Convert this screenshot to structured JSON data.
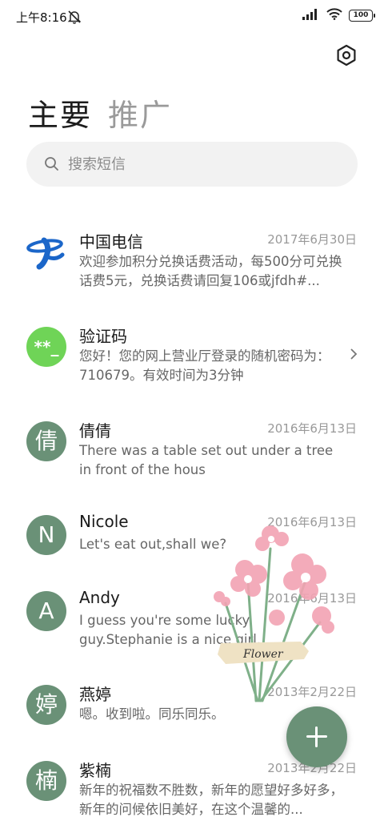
{
  "status_bar": {
    "time": "上午8:16",
    "battery": "100"
  },
  "tabs": [
    {
      "label": "主要",
      "active": true
    },
    {
      "label": "推广",
      "active": false
    }
  ],
  "search": {
    "placeholder": "搜索短信"
  },
  "accent_color": "#6a9177",
  "conversations": [
    {
      "name": "中国电信",
      "date": "2017年6月30日",
      "preview": "欢迎参加积分兑换话费活动，每500分可兑换话费5元，兑换话费请回复106或jfdh#...",
      "avatar": "china-telecom-logo"
    },
    {
      "name": "验证码",
      "date": "",
      "preview": "您好！您的网上营业厅登录的随机密码为：710679。有效时间为3分钟",
      "avatar": "**_"
    },
    {
      "name": "倩倩",
      "date": "2016年6月13日",
      "preview": "There was a table set out under a tree in front of the hous",
      "avatar": "倩"
    },
    {
      "name": "Nicole",
      "date": "2016年6月13日",
      "preview": "Let's eat out,shall we?",
      "avatar": "N"
    },
    {
      "name": "Andy",
      "date": "2016年6月13日",
      "preview": "I guess you're some lucky guy.Stephanie is a nice girl.",
      "avatar": "A"
    },
    {
      "name": "燕婷",
      "date": "2013年2月22日",
      "preview": "嗯。收到啦。同乐同乐。",
      "avatar": "婷"
    },
    {
      "name": "紫楠",
      "date": "2013年2月22日",
      "preview": "新年的祝福数不胜数，新年的愿望好多好多，新年的问候依旧美好，在这个温馨的...",
      "avatar": "楠"
    }
  ],
  "sticker": {
    "label": "Flower"
  }
}
